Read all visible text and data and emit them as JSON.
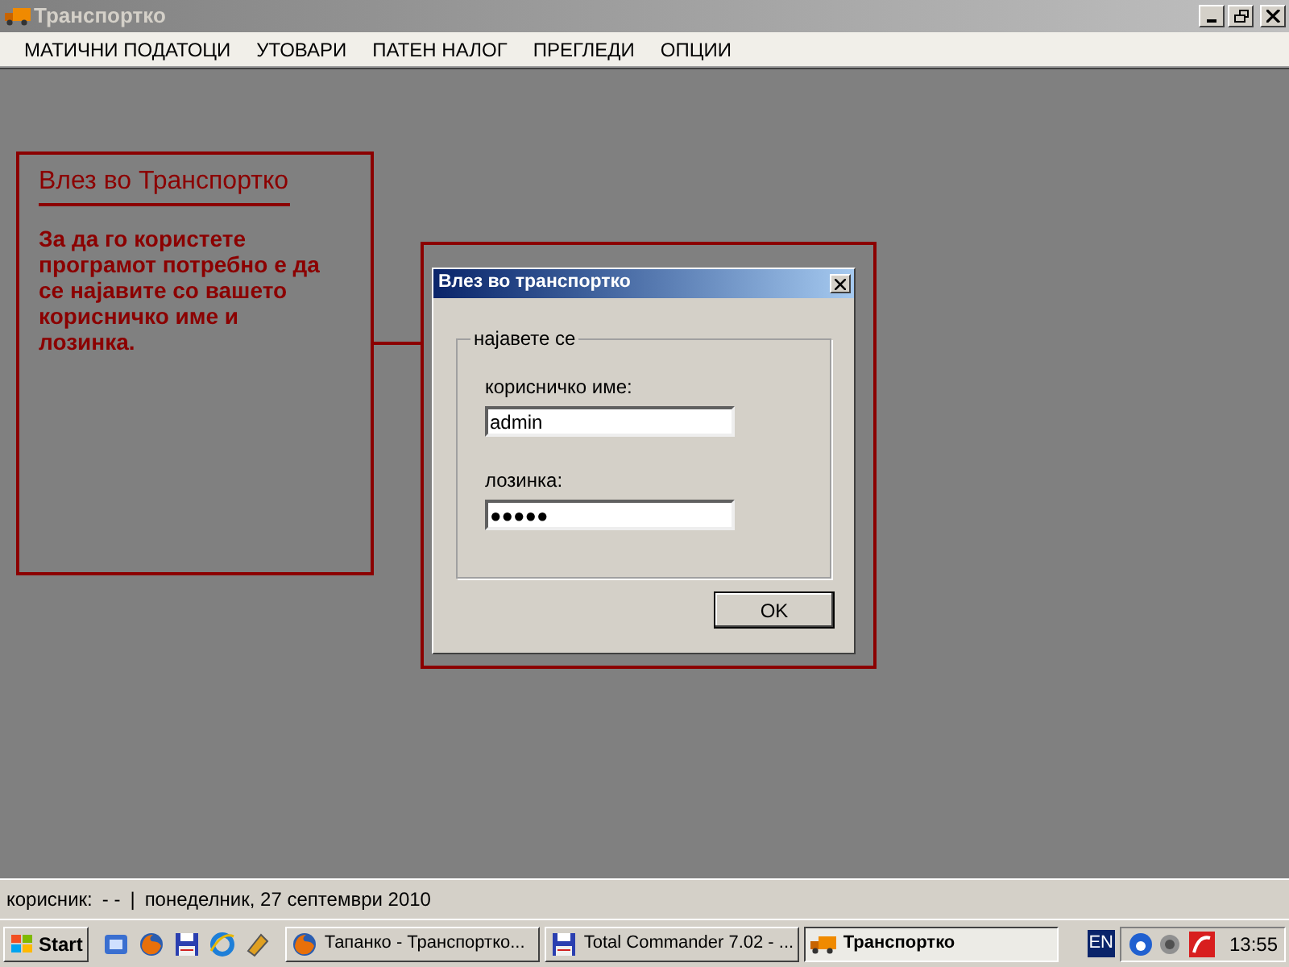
{
  "window": {
    "title": "Транспортко",
    "active": false
  },
  "menu": [
    {
      "label": "МАТИЧНИ ПОДАТОЦИ"
    },
    {
      "label": "УТОВАРИ"
    },
    {
      "label": "ПАТЕН НАЛОГ"
    },
    {
      "label": "ПРЕГЛЕДИ"
    },
    {
      "label": "ОПЦИИ"
    }
  ],
  "info_box": {
    "title": "Влез во Транспортко",
    "text": "За да го користете програмот потребно е да се најавите со вашето корисничко име и лозинка."
  },
  "dialog": {
    "title": "Влез во транспортко",
    "group_label": "најавете се",
    "fields": [
      {
        "label": "корисничко име:",
        "value": "admin"
      },
      {
        "label": "лозинка:",
        "value": "●●●●●"
      }
    ],
    "ok_button": "OK"
  },
  "status_bar": {
    "user_label": "корисник:",
    "user": "- -",
    "separator": "|",
    "date": "понеделник, 27 септември 2010"
  },
  "taskbar": {
    "start": "Start",
    "tasks": [
      {
        "label": "Тапанко - Транспортко...",
        "kind": "browser",
        "selected": false
      },
      {
        "label": "Total Commander 7.02 - ...",
        "kind": "disk",
        "selected": false
      },
      {
        "label": "Транспортко",
        "kind": "truck",
        "selected": true
      }
    ],
    "language": "EN",
    "clock": "13:55"
  }
}
